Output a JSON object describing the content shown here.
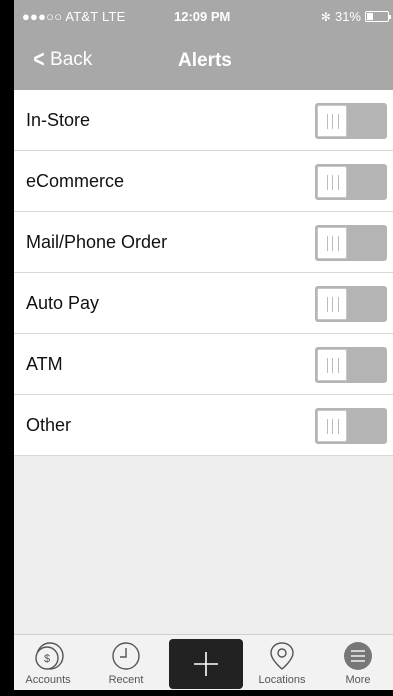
{
  "status": {
    "carrier": "●●●○○ AT&T  LTE",
    "time": "12:09 PM",
    "bluetooth": "✻",
    "battery_text": "31%",
    "battery_level": 0.31
  },
  "nav": {
    "back_label": "Back",
    "title": "Alerts"
  },
  "alerts": [
    {
      "label": "In-Store",
      "enabled": false
    },
    {
      "label": "eCommerce",
      "enabled": false
    },
    {
      "label": "Mail/Phone Order",
      "enabled": false
    },
    {
      "label": "Auto Pay",
      "enabled": false
    },
    {
      "label": "ATM",
      "enabled": false
    },
    {
      "label": "Other",
      "enabled": false
    }
  ],
  "tabs": {
    "accounts": "Accounts",
    "recent": "Recent",
    "locations": "Locations",
    "more": "More"
  },
  "icons": {
    "accounts": "dollar-coins-icon",
    "recent": "clock-icon",
    "add": "plus-icon",
    "locations": "map-pin-icon",
    "more": "menu-icon"
  }
}
